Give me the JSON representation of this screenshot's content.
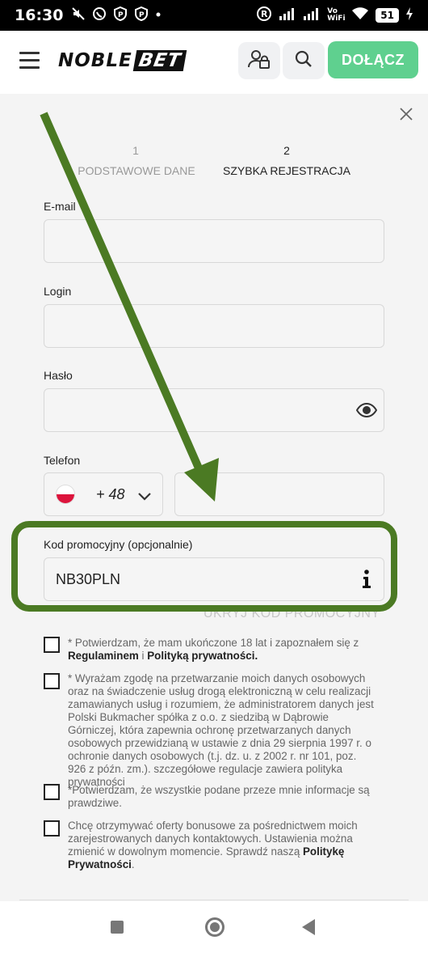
{
  "status_bar": {
    "time": "16:30",
    "left_icons": [
      "no-sound-icon",
      "whatsapp-icon",
      "p-icon",
      "p-icon",
      "dot-icon"
    ],
    "right_icons": [
      "registered-icon",
      "signal-icon",
      "signal-icon",
      "vowifi-icon",
      "wifi-icon",
      "battery-icon",
      "charging-icon"
    ],
    "vowifi": "Vo WiFi",
    "battery": "51"
  },
  "header": {
    "logo_noble": "NOBLE",
    "logo_bet": "BET",
    "join_label": "DOŁĄCZ"
  },
  "steps": [
    {
      "number": "1",
      "label": "PODSTAWOWE DANE",
      "active": false
    },
    {
      "number": "2",
      "label": "SZYBKA REJESTRACJA",
      "active": true
    }
  ],
  "form": {
    "email_label": "E-mail",
    "login_label": "Login",
    "password_label": "Hasło",
    "phone_label": "Telefon",
    "phone_prefix": "+ 48",
    "promo_label": "Kod promocyjny (opcjonalnie)",
    "promo_value": "NB30PLN",
    "hide_promo": "UKRYJ KOD PROMOCYJNY"
  },
  "consents": {
    "c1_a": "* Potwierdzam, że mam ukończone 18 lat i zapoznałem się z ",
    "c1_b": "Regulaminem",
    "c1_c": " i ",
    "c1_d": "Polityką prywatności.",
    "c2": "* Wyrażam zgodę na przetwarzanie moich danych osobowych oraz na świadczenie usług drogą elektroniczną w celu realizacji zamawianych usług i rozumiem, że administratorem danych jest Polski Bukmacher spółka z o.o. z siedzibą w Dąbrowie Górniczej, która zapewnia ochronę przetwarzanych danych osobowych przewidzianą w ustawie z dnia 29 sierpnia 1997 r. o ochronie danych osobowych (t.j. dz. u. z 2002 r. nr 101, poz. 926 z późn. zm.). szczegółowe regulacje zawiera polityka prywatności",
    "c3": "*Potwierdzam, że wszystkie podane przeze mnie informacje są prawdziwe.",
    "c4_a": "Chcę otrzymywać oferty bonusowe za pośrednictwem moich zarejestrowanych danych kontaktowych. Ustawienia można zmienić w dowolnym momencie. Sprawdź naszą ",
    "c4_b": "Politykę Prywatności",
    "c4_c": "."
  },
  "colors": {
    "join_button": "#5fd08f",
    "annotation_green": "#4b7a23"
  }
}
